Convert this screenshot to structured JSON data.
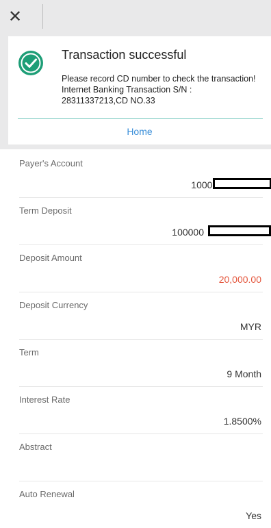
{
  "header": {
    "close_glyph": "✕"
  },
  "result": {
    "title": "Transaction successful",
    "message_line1": "Please record CD number to check the transaction!",
    "message_line2": "Internet Banking Transaction S/N :",
    "message_line3": "28311337213,CD NO.33",
    "home_label": "Home",
    "icon": "check-circle-icon",
    "icon_color": "#1e9e77"
  },
  "details": [
    {
      "label": "Payer's Account",
      "value": "100000"
    },
    {
      "label": "Term Deposit",
      "value": "100000"
    },
    {
      "label": "Deposit Amount",
      "value": "20,000.00"
    },
    {
      "label": "Deposit Currency",
      "value": "MYR"
    },
    {
      "label": "Term",
      "value": "9 Month"
    },
    {
      "label": "Interest Rate",
      "value": "1.8500%"
    },
    {
      "label": "Abstract",
      "value": ""
    },
    {
      "label": "Auto Renewal",
      "value": "Yes"
    }
  ],
  "colors": {
    "amount": "#e4553b",
    "link": "#3b8fd9",
    "accent_line": "#6ac4b9"
  }
}
